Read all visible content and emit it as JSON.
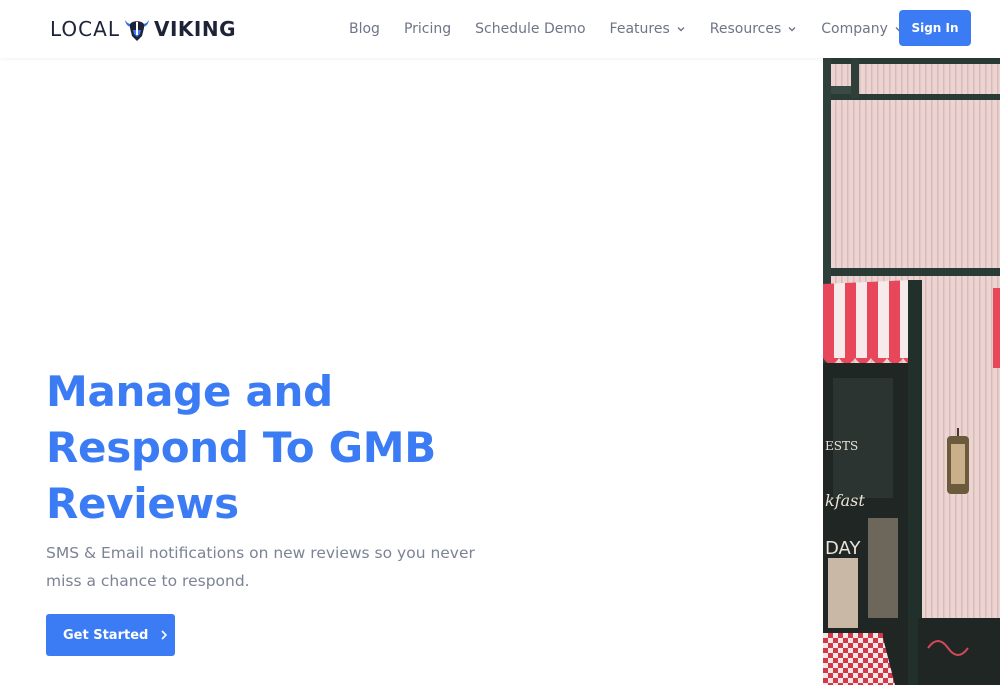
{
  "brand": {
    "name_left": "LOCAL",
    "name_right": "VIKING",
    "logo_icon": "viking-helmet-icon"
  },
  "nav": {
    "items": [
      {
        "label": "Blog",
        "dropdown": false
      },
      {
        "label": "Pricing",
        "dropdown": false
      },
      {
        "label": "Schedule Demo",
        "dropdown": false
      },
      {
        "label": "Features",
        "dropdown": true
      },
      {
        "label": "Resources",
        "dropdown": true
      },
      {
        "label": "Company",
        "dropdown": true
      }
    ],
    "signin_label": "Sign In"
  },
  "hero": {
    "title_lines": [
      "Manage and",
      "Respond To GMB",
      "Reviews"
    ],
    "subtitle_lines": [
      "SMS & Email notifications on new reviews so you never",
      "miss a chance to respond."
    ],
    "cta_label": "Get Started",
    "image_alt_icon": "storefront-photo"
  },
  "colors": {
    "accent": "#3b7cf5",
    "brand_dark": "#1e2438",
    "nav_text": "#6e7587",
    "subtitle_text": "#7b8394"
  }
}
